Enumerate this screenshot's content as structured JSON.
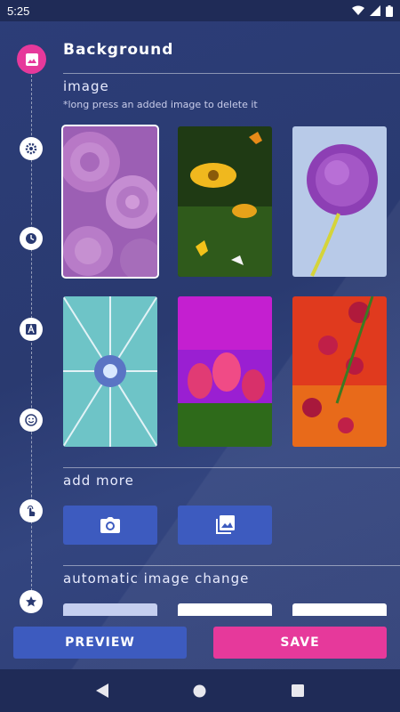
{
  "status_bar": {
    "time": "5:25"
  },
  "header": {
    "title": "Background"
  },
  "image_section": {
    "title": "image",
    "hint": "*long press an added image to delete it",
    "images": [
      {
        "name": "pink roses",
        "selected": true
      },
      {
        "name": "butterflies on yellow flowers",
        "selected": false
      },
      {
        "name": "purple allium flower",
        "selected": false
      },
      {
        "name": "cyan burst",
        "selected": false
      },
      {
        "name": "pink tulips",
        "selected": false
      },
      {
        "name": "red poppies",
        "selected": false
      }
    ]
  },
  "add_more": {
    "title": "add more",
    "camera_icon": "camera-icon",
    "gallery_icon": "gallery-icon"
  },
  "auto_change": {
    "title": "automatic image change"
  },
  "actions": {
    "preview": "PREVIEW",
    "save": "SAVE"
  },
  "timeline_icons": [
    "image-icon",
    "gear-icon",
    "clock-icon",
    "text-icon",
    "smiley-icon",
    "touch-icon",
    "star-icon"
  ],
  "colors": {
    "accent_pink": "#e6399b",
    "button_blue": "#3d5bbf",
    "background": "#2a3a72"
  }
}
